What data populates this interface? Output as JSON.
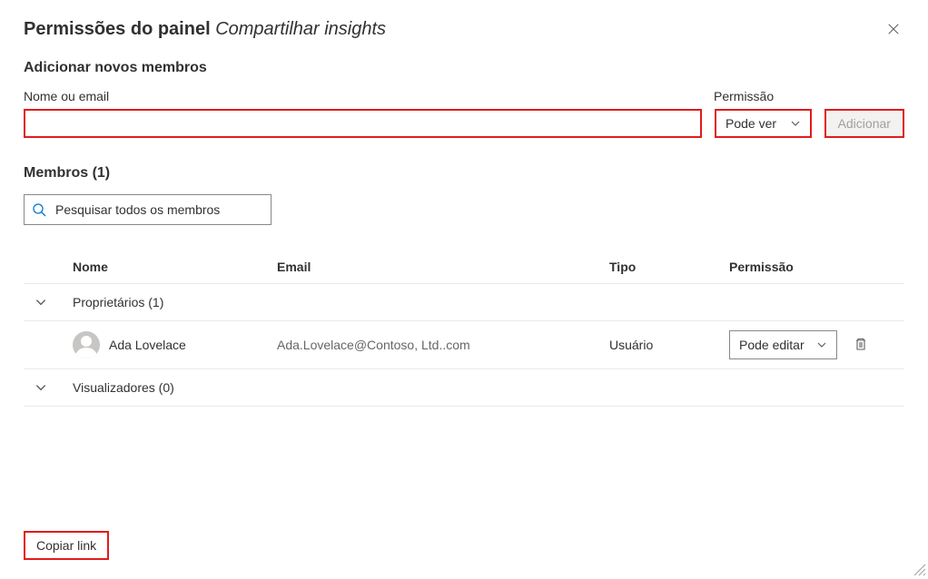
{
  "title_prefix": "Permissões do painel",
  "title_panel_name": "Compartilhar insights",
  "add_section_heading": "Adicionar novos membros",
  "name_field_label": "Nome ou email",
  "permission_field_label": "Permissão",
  "permission_select_value": "Pode ver",
  "add_button_label": "Adicionar",
  "members_heading": "Membros (1)",
  "search_placeholder": "Pesquisar todos os membros",
  "table": {
    "columns": {
      "name": "Nome",
      "email": "Email",
      "type": "Tipo",
      "permission": "Permissão"
    },
    "groups": {
      "owners": {
        "label": "Proprietários (1)"
      },
      "viewers": {
        "label": "Visualizadores (0)"
      }
    },
    "rows": {
      "ada": {
        "name": "Ada Lovelace",
        "email": "Ada.Lovelace@Contoso, Ltd..com",
        "type": "Usuário",
        "permission": "Pode editar"
      }
    }
  },
  "copy_link_label": "Copiar link",
  "colors": {
    "highlight_border": "#e31b1b",
    "search_icon": "#0078d4"
  }
}
